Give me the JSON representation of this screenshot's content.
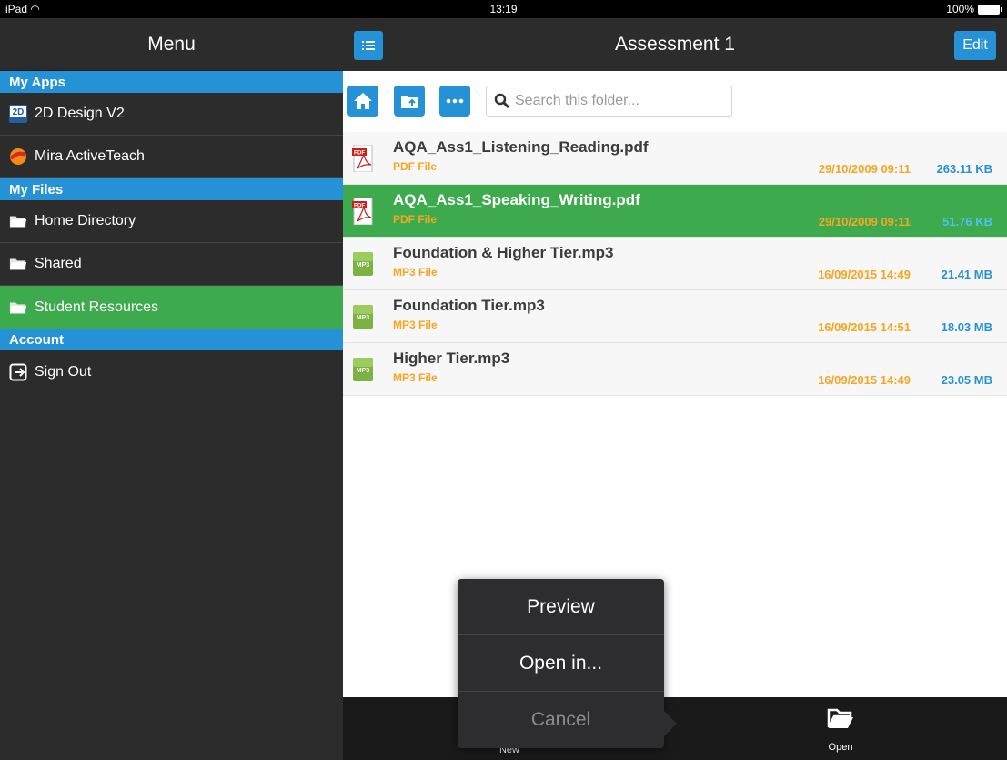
{
  "status": {
    "device": "iPad",
    "time": "13:19",
    "battery": "100%"
  },
  "sidebar": {
    "title": "Menu",
    "sections": [
      {
        "header": "My Apps",
        "items": [
          {
            "label": "2D Design V2",
            "icon": "2d-design-icon"
          },
          {
            "label": "Mira ActiveTeach",
            "icon": "mira-icon"
          }
        ]
      },
      {
        "header": "My Files",
        "items": [
          {
            "label": "Home Directory",
            "icon": "folder-icon"
          },
          {
            "label": "Shared",
            "icon": "folder-icon"
          },
          {
            "label": "Student Resources",
            "icon": "folder-icon",
            "selected": true
          }
        ]
      },
      {
        "header": "Account",
        "items": [
          {
            "label": "Sign Out",
            "icon": "sign-out-icon"
          }
        ]
      }
    ]
  },
  "main": {
    "title": "Assessment 1",
    "edit_label": "Edit",
    "search_placeholder": "Search this folder...",
    "files": [
      {
        "name": "AQA_Ass1_Listening_Reading.pdf",
        "type": "PDF File",
        "date": "29/10/2009 09:11",
        "size": "263.11 KB",
        "icon": "pdf-icon"
      },
      {
        "name": "AQA_Ass1_Speaking_Writing.pdf",
        "type": "PDF File",
        "date": "29/10/2009 09:11",
        "size": "51.76 KB",
        "icon": "pdf-icon",
        "selected": true
      },
      {
        "name": "Foundation & Higher Tier.mp3",
        "type": "MP3 File",
        "date": "16/09/2015 14:49",
        "size": "21.41 MB",
        "icon": "mp3-icon"
      },
      {
        "name": "Foundation Tier.mp3",
        "type": "MP3 File",
        "date": "16/09/2015 14:51",
        "size": "18.03 MB",
        "icon": "mp3-icon"
      },
      {
        "name": "Higher Tier.mp3",
        "type": "MP3 File",
        "date": "16/09/2015 14:49",
        "size": "23.05 MB",
        "icon": "mp3-icon"
      }
    ]
  },
  "bottombar": {
    "new_label": "New",
    "open_label": "Open"
  },
  "popover": {
    "preview": "Preview",
    "open_in": "Open in...",
    "cancel": "Cancel"
  },
  "colors": {
    "accent": "#2592d8",
    "selected": "#3daa4d",
    "orange": "#f5a623"
  }
}
